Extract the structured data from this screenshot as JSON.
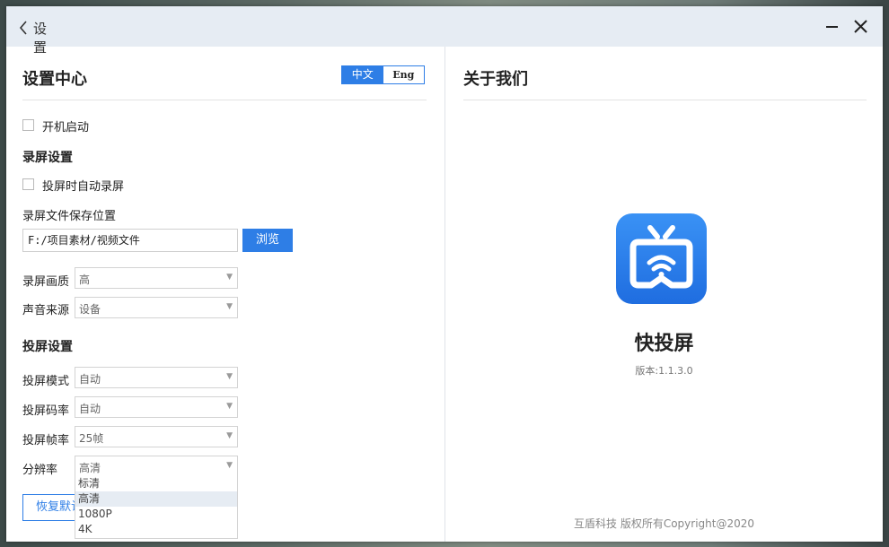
{
  "titlebar": {
    "back_label": "设置"
  },
  "left": {
    "title": "设置中心",
    "lang": {
      "zh": "中文",
      "en": "Eng"
    },
    "autostart_label": "开机启动",
    "record_section": "录屏设置",
    "auto_record_label": "投屏时自动录屏",
    "save_path_label": "录屏文件保存位置",
    "save_path_value": "F:/项目素材/视频文件",
    "browse_label": "浏览",
    "record_quality": {
      "label": "录屏画质",
      "value": "高"
    },
    "audio_source": {
      "label": "声音来源",
      "value": "设备"
    },
    "cast_section": "投屏设置",
    "cast_mode": {
      "label": "投屏模式",
      "value": "自动"
    },
    "cast_bitrate": {
      "label": "投屏码率",
      "value": "自动"
    },
    "cast_framerate": {
      "label": "投屏帧率",
      "value": "25帧"
    },
    "resolution": {
      "label": "分辨率",
      "value": "高清",
      "options": [
        "标清",
        "高清",
        "1080P",
        "4K"
      ]
    },
    "restore_label": "恢复默认"
  },
  "right": {
    "title": "关于我们",
    "app_name": "快投屏",
    "version": "版本:1.1.3.0",
    "copyright": "互盾科技 版权所有Copyright@2020"
  },
  "colors": {
    "accent": "#2e7ee6",
    "titlebar": "#e6ecf3"
  }
}
